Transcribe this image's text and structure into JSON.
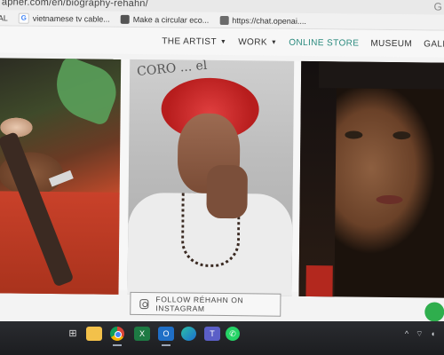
{
  "browser": {
    "url_text": "apher.com/en/biography-rehahn/",
    "bookmarks": [
      {
        "label": "AL",
        "favicon": "page-icon"
      },
      {
        "label": "vietnamese tv cable...",
        "favicon": "google-icon"
      },
      {
        "label": "Make a circular eco...",
        "favicon": "page-icon"
      },
      {
        "label": "https://chat.openai....",
        "favicon": "page-icon"
      }
    ]
  },
  "nav": {
    "items": [
      {
        "label": "THE ARTIST",
        "has_dropdown": true
      },
      {
        "label": "WORK",
        "has_dropdown": true
      },
      {
        "label": "ONLINE STORE",
        "has_dropdown": false,
        "active": true
      },
      {
        "label": "MUSEUM",
        "has_dropdown": false
      },
      {
        "label": "GALLE",
        "has_dropdown": false
      }
    ],
    "active_color": "#2a8a7e"
  },
  "gallery": {
    "photos": [
      {
        "subject": "elderly-woman-smoking-pipe-portrait"
      },
      {
        "subject": "woman-with-red-headdress-portrait",
        "scrawl": "CORO ... el"
      },
      {
        "subject": "young-woman-close-up-portrait"
      }
    ]
  },
  "instagram_button": {
    "label": "FOLLOW RÉHAHN ON INSTAGRAM",
    "icon": "instagram-icon"
  },
  "taskbar": {
    "apps": [
      "task-view-icon",
      "file-explorer-icon",
      "chrome-icon",
      "excel-icon",
      "outlook-icon",
      "edge-icon",
      "teams-icon",
      "whatsapp-icon"
    ],
    "tray": [
      "^",
      "wifi-icon",
      "volume-icon"
    ]
  }
}
